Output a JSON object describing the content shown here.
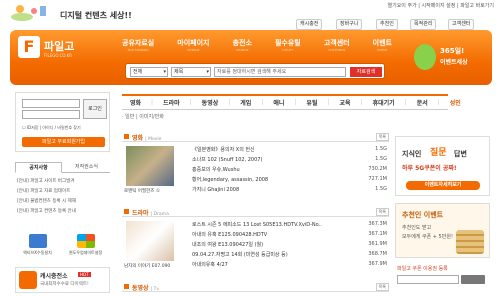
{
  "top_links": "열기요이 주가 | 시작페이지 설정 | 파일고 바로가기",
  "tagline": "디지털 컨텐츠 세상!!",
  "util": {
    "cash": "캐시충전",
    "wallet": "장바구니",
    "recommend": "추천인",
    "faq": "목적관리",
    "support": "고객센터"
  },
  "logo": {
    "mark": "F",
    "name": "파일고",
    "sub": "FILEGO.CO.KR"
  },
  "nav": [
    {
      "label": "공유자료실",
      "sub": "FILE SHARING"
    },
    {
      "label": "마이페이지",
      "sub": "MYPAGE"
    },
    {
      "label": "충전소",
      "sub": "CHARGE"
    },
    {
      "label": "필수유틸",
      "sub": "UTILITY"
    },
    {
      "label": "고객센터",
      "sub": "CUSTOMER"
    },
    {
      "label": "이벤트",
      "sub": "EVENT"
    }
  ],
  "search": {
    "cat1": "전체",
    "cat2": "제목",
    "placeholder": "자료를 정대하시면 검색해 주세요",
    "button": "자료검색"
  },
  "event365": {
    "line1": "365일!",
    "line2": "이벤트세상"
  },
  "login": {
    "button": "로그인",
    "options": "ID저장 | 아이디 / 비밀번호 찾기",
    "join": "파일고 무료회원가입"
  },
  "left_tabs": [
    "공지사항",
    "저작권소식"
  ],
  "notices": [
    "[안내] 파일고 사이트 버그발겨",
    "[안내] 파일고 자료 업데이트",
    "[안내] 불법컨텐츠 등록 시 제재",
    "[안내] 파일고 컨텐츠 등록 안내"
  ],
  "shortcuts": [
    {
      "label": "엑티브X수동설치",
      "color": "#3b7bd0"
    },
    {
      "label": "윈도우업데이트설정",
      "color": "#5fb040"
    }
  ],
  "cash_banner": {
    "title": "캐시충전소",
    "sub": "국내최저수수료 다이렉트!",
    "badge": "HOT"
  },
  "category_tabs": [
    "영화",
    "드라마",
    "동영상",
    "게임",
    "애니",
    "유틸",
    "교육",
    "휴대기기",
    "문서",
    "성인"
  ],
  "sub_tabs": "· 일반 | 이미지/만화",
  "sections": [
    {
      "title": "영화",
      "en": "Movie",
      "more": "목록",
      "caption": "로맨틱 어필한즈 ①",
      "rows": [
        {
          "title": "《일본영화》용의자 X의 헌신",
          "size": "1.5G"
        },
        {
          "title": "소나프 102 (Snuff 102, 2007)",
          "size": "1.5G"
        },
        {
          "title": "흥중보의 우슈,Wushu",
          "size": "730.2M"
        },
        {
          "title": "황어,legendary, assassin, 2008",
          "size": "727.1M"
        },
        {
          "title": "가지니 Ghajini 2008",
          "size": "1.5G"
        }
      ]
    },
    {
      "title": "드라마",
      "en": "Drama",
      "more": "목록",
      "caption": "남자의 이야기 E07.090",
      "rows": [
        {
          "title": "로스트 시즌 5 에피소드 13 Lost S05E13.HDTV.XviD-No..",
          "size": "367.3M"
        },
        {
          "title": "아내의 유혹 E125.090428.HDTV",
          "size": "367.1M"
        },
        {
          "title": "내조의 여왕 E13.090427일 (월)",
          "size": "361.9M"
        },
        {
          "title": "09.04.27.자명고 14회 (미연성 등급미상 등)",
          "size": "368.7M"
        },
        {
          "title": "아내의유혹 4/27",
          "size": "367.9M"
        }
      ]
    }
  ],
  "video_section": {
    "title": "동영상",
    "en": "Tv",
    "more": "목록"
  },
  "ad1": {
    "l1": "지식인",
    "l2": "질문",
    "l3": "답변",
    "l4": "하루 5G쿠폰이 공짜!",
    "btn": "이벤트자세히보기"
  },
  "ad2": {
    "l1": "추천인 이벤트",
    "l2": "추천인도 받고",
    "l3": "모두에게 쿠폰 + 5만원!"
  },
  "coupon": {
    "label": "파일고 쿠폰 이용권 등록"
  }
}
